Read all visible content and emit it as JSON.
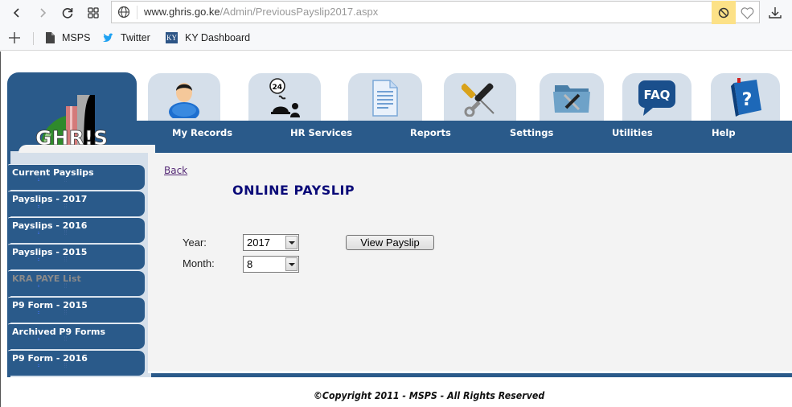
{
  "browser": {
    "url_host": "www.ghris.go.ke",
    "url_path": "/Admin/PreviousPayslip2017.aspx",
    "bookmarks": [
      {
        "label": "MSPS",
        "icon": "file-icon"
      },
      {
        "label": "Twitter",
        "icon": "twitter-icon"
      },
      {
        "label": "KY Dashboard",
        "icon": "ky-icon",
        "icon_text": "KY"
      }
    ]
  },
  "site": {
    "logo_text": "GHR!S",
    "nav": [
      {
        "label": "My Records",
        "icon": "user-icon"
      },
      {
        "label": "HR Services",
        "icon": "service-24-icon"
      },
      {
        "label": "Reports",
        "icon": "document-icon"
      },
      {
        "label": "Settings",
        "icon": "tools-icon"
      },
      {
        "label": "Utilities",
        "icon": "folder-tools-icon"
      },
      {
        "label": "Help",
        "icon": "help-book-icon"
      }
    ],
    "faq_icon_text": "FAQ",
    "help_icon_text": "?"
  },
  "sidebar": {
    "items": [
      {
        "label": "Current Payslips",
        "enabled": true
      },
      {
        "label": "Payslips - 2017",
        "enabled": true
      },
      {
        "label": "Payslips - 2016",
        "enabled": true
      },
      {
        "label": "Payslips - 2015",
        "enabled": true
      },
      {
        "label": "KRA PAYE List",
        "enabled": false
      },
      {
        "label": "P9 Form - 2015",
        "enabled": true
      },
      {
        "label": "Archived P9 Forms",
        "enabled": true
      },
      {
        "label": "P9 Form - 2016",
        "enabled": true
      }
    ]
  },
  "main": {
    "back_label": "Back",
    "title": "ONLINE PAYSLIP",
    "year_label": "Year:",
    "year_value": "2017",
    "month_label": "Month:",
    "month_value": "8",
    "view_button": "View Payslip"
  },
  "footer": {
    "copyright": "©Copyright 2011 - MSPS - All Rights Reserved"
  },
  "colors": {
    "brand_blue": "#2a5a8a",
    "tab_bg": "#d5dfea",
    "title_navy": "#0a0a78"
  }
}
